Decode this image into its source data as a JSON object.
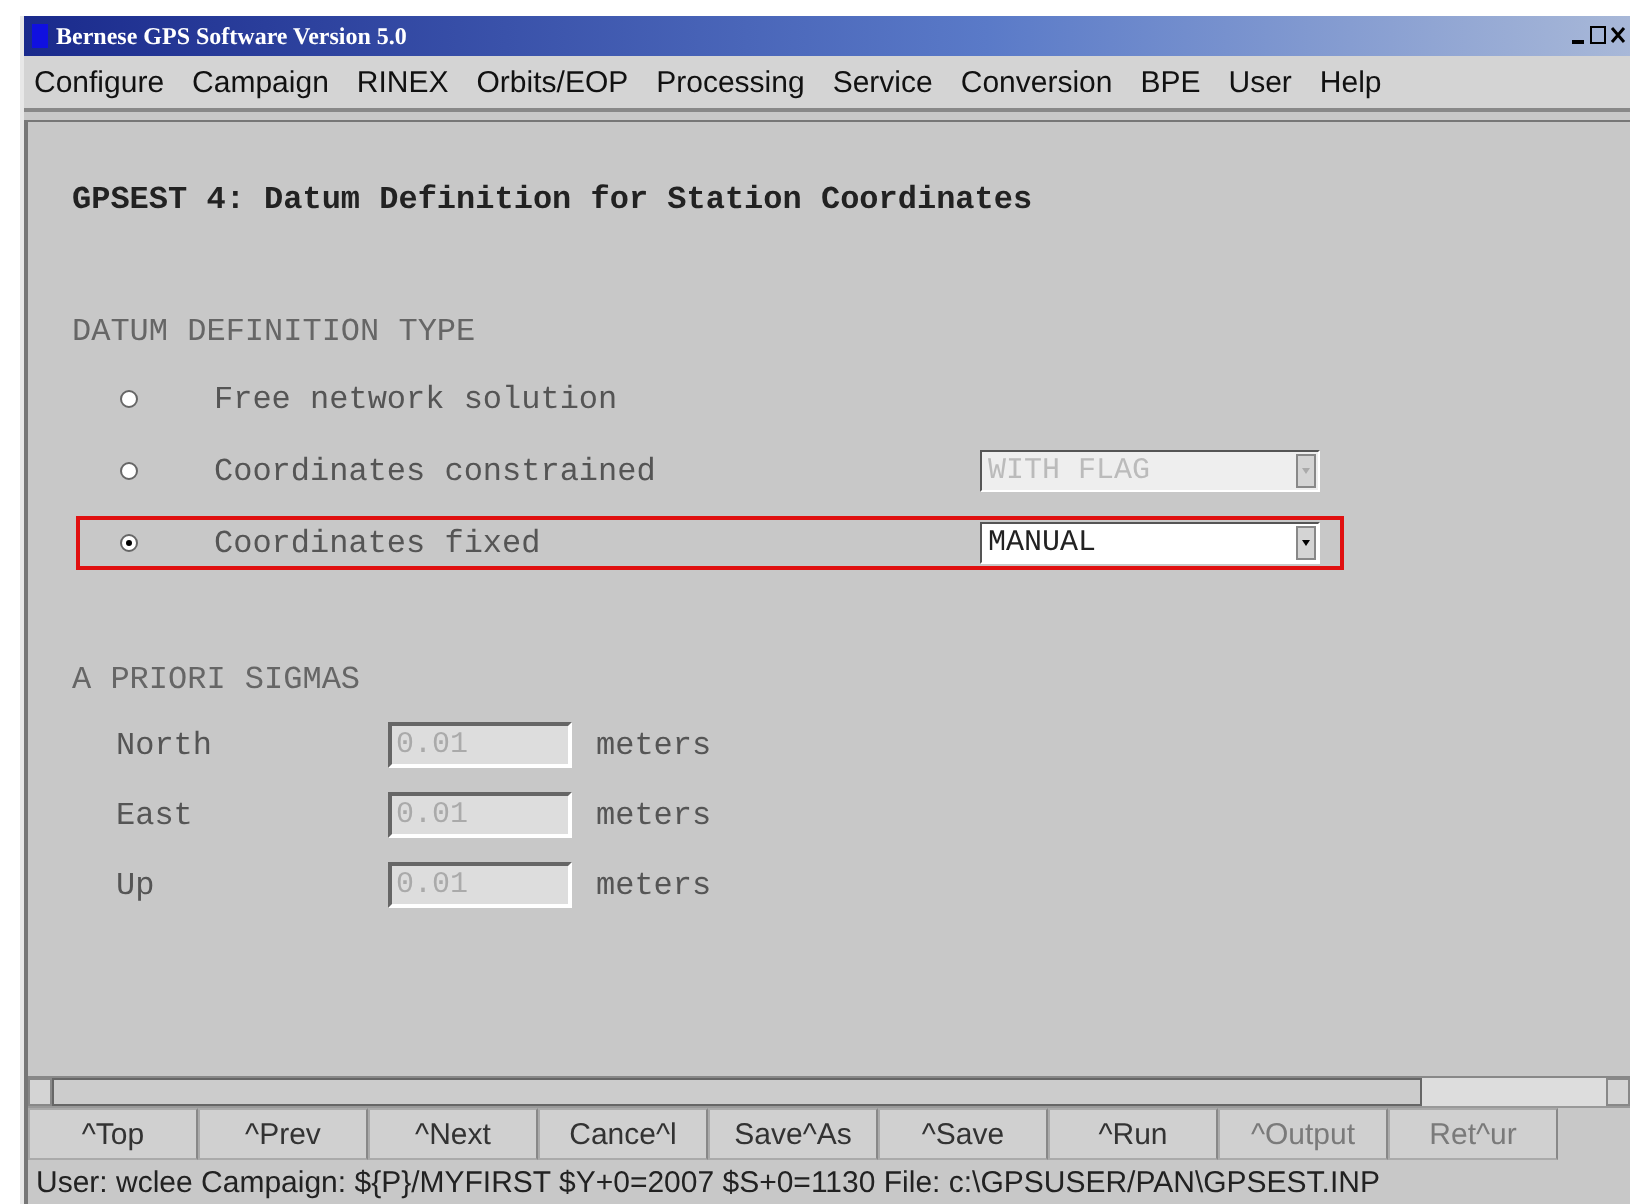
{
  "window": {
    "title": "Bernese GPS Software Version 5.0"
  },
  "menu": [
    {
      "label": "Configure"
    },
    {
      "label": "Campaign"
    },
    {
      "label": "RINEX"
    },
    {
      "label": "Orbits/EOP"
    },
    {
      "label": "Processing"
    },
    {
      "label": "Service"
    },
    {
      "label": "Conversion"
    },
    {
      "label": "BPE"
    },
    {
      "label": "User"
    },
    {
      "label": "Help"
    }
  ],
  "panel": {
    "heading": "GPSEST 4: Datum Definition for Station Coordinates",
    "datum_section": {
      "title": "DATUM DEFINITION TYPE",
      "options": [
        {
          "label": "Free network solution",
          "selected": false,
          "highlighted": false
        },
        {
          "label": "Coordinates constrained",
          "selected": false,
          "highlighted": false,
          "dropdown": {
            "value": "WITH FLAG",
            "disabled": true
          }
        },
        {
          "label": "Coordinates fixed",
          "selected": true,
          "highlighted": true,
          "dropdown": {
            "value": "MANUAL",
            "disabled": false
          }
        }
      ]
    },
    "sigma_section": {
      "title": "A PRIORI SIGMAS",
      "rows": [
        {
          "label": "North",
          "value": "0.01",
          "unit": "meters",
          "disabled": true
        },
        {
          "label": "East",
          "value": "0.01",
          "unit": "meters",
          "disabled": true
        },
        {
          "label": "Up",
          "value": "0.01",
          "unit": "meters",
          "disabled": true
        }
      ]
    }
  },
  "buttons": [
    {
      "label": "^Top",
      "disabled": false
    },
    {
      "label": "^Prev",
      "disabled": false
    },
    {
      "label": "^Next",
      "disabled": false
    },
    {
      "label": "Cance^l",
      "disabled": false
    },
    {
      "label": "Save^As",
      "disabled": false
    },
    {
      "label": "^Save",
      "disabled": false
    },
    {
      "label": "^Run",
      "disabled": false
    },
    {
      "label": "^Output",
      "disabled": true
    },
    {
      "label": "Ret^ur",
      "disabled": true
    }
  ],
  "status_bar": "User: wclee  Campaign: ${P}/MYFIRST   $Y+0=2007  $S+0=1130   File: c:\\GPSUSER/PAN\\GPSEST.INP"
}
